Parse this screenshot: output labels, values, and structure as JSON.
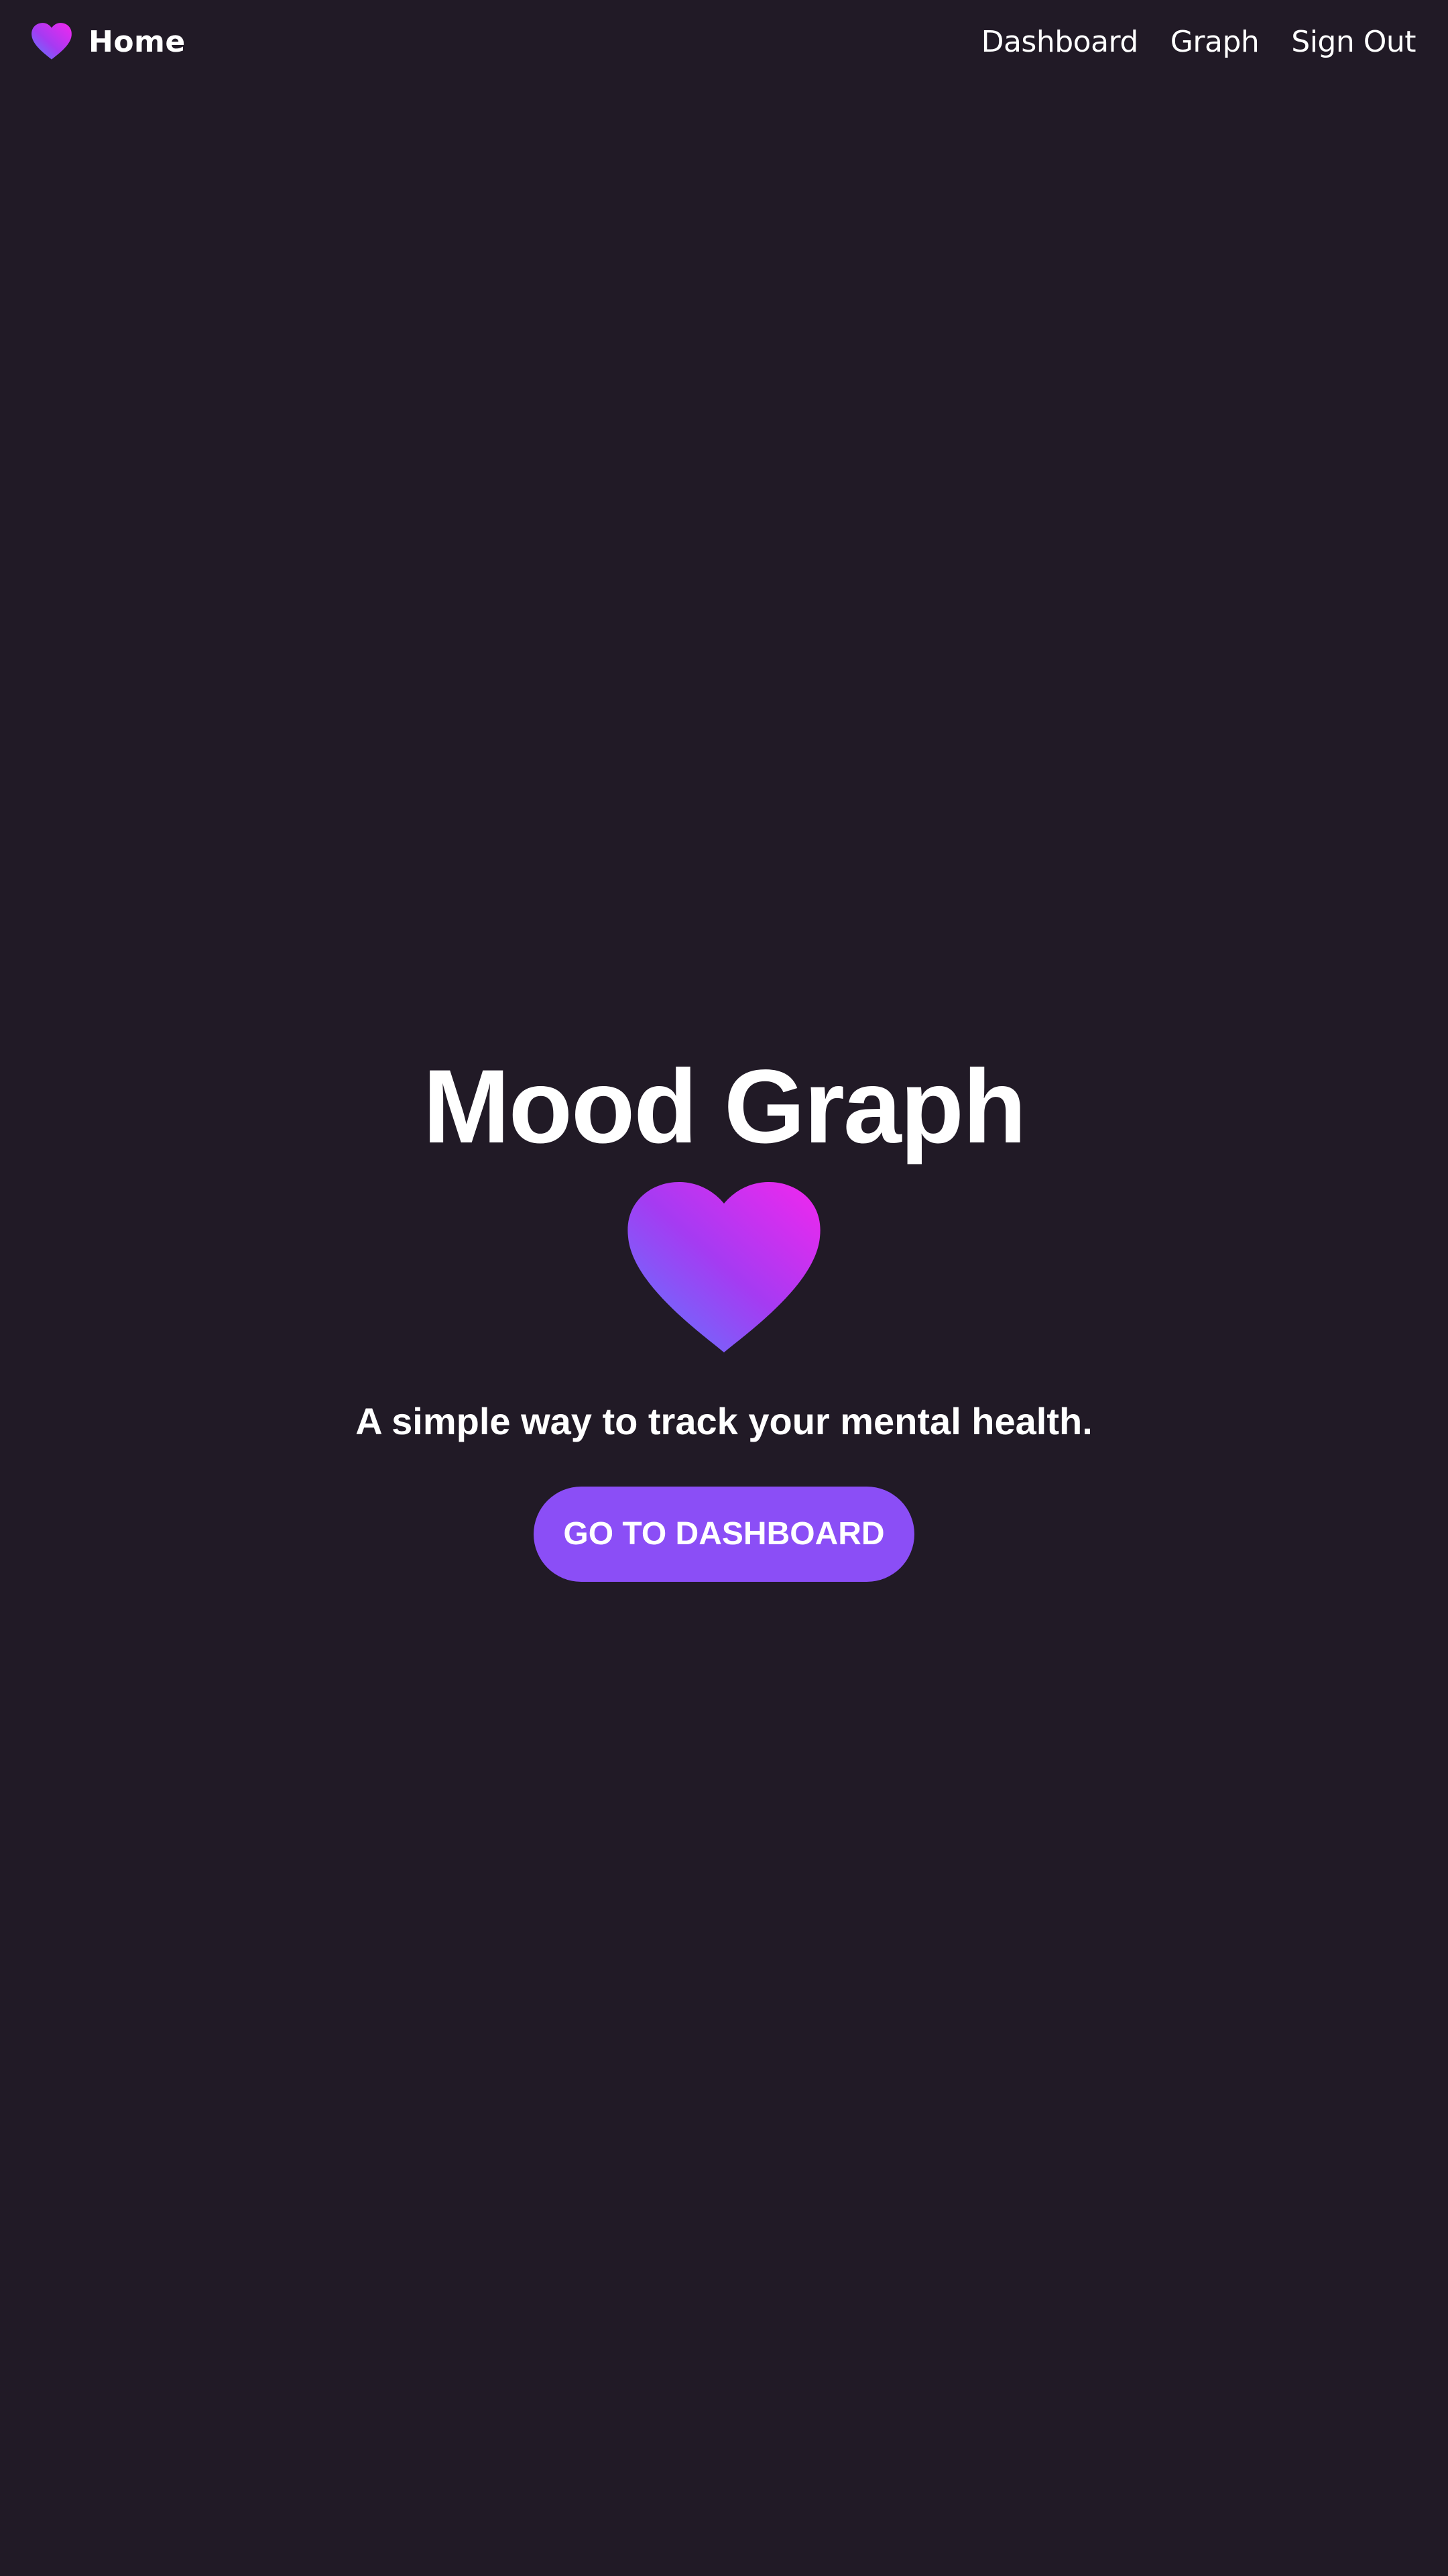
{
  "nav": {
    "brand_label": "Home",
    "brand_icon": "heart-icon",
    "links": [
      {
        "label": "Dashboard"
      },
      {
        "label": "Graph"
      },
      {
        "label": "Sign Out"
      }
    ]
  },
  "hero": {
    "title": "Mood Graph",
    "icon": "heart-icon",
    "subtitle": "A simple way to track your mental health.",
    "cta_label": "GO TO DASHBOARD"
  },
  "colors": {
    "background": "#211a26",
    "accent": "#8b4ef6",
    "gradient_start": "#5b7cff",
    "gradient_mid": "#a53bf2",
    "gradient_end": "#f227ee",
    "text": "#ffffff"
  }
}
